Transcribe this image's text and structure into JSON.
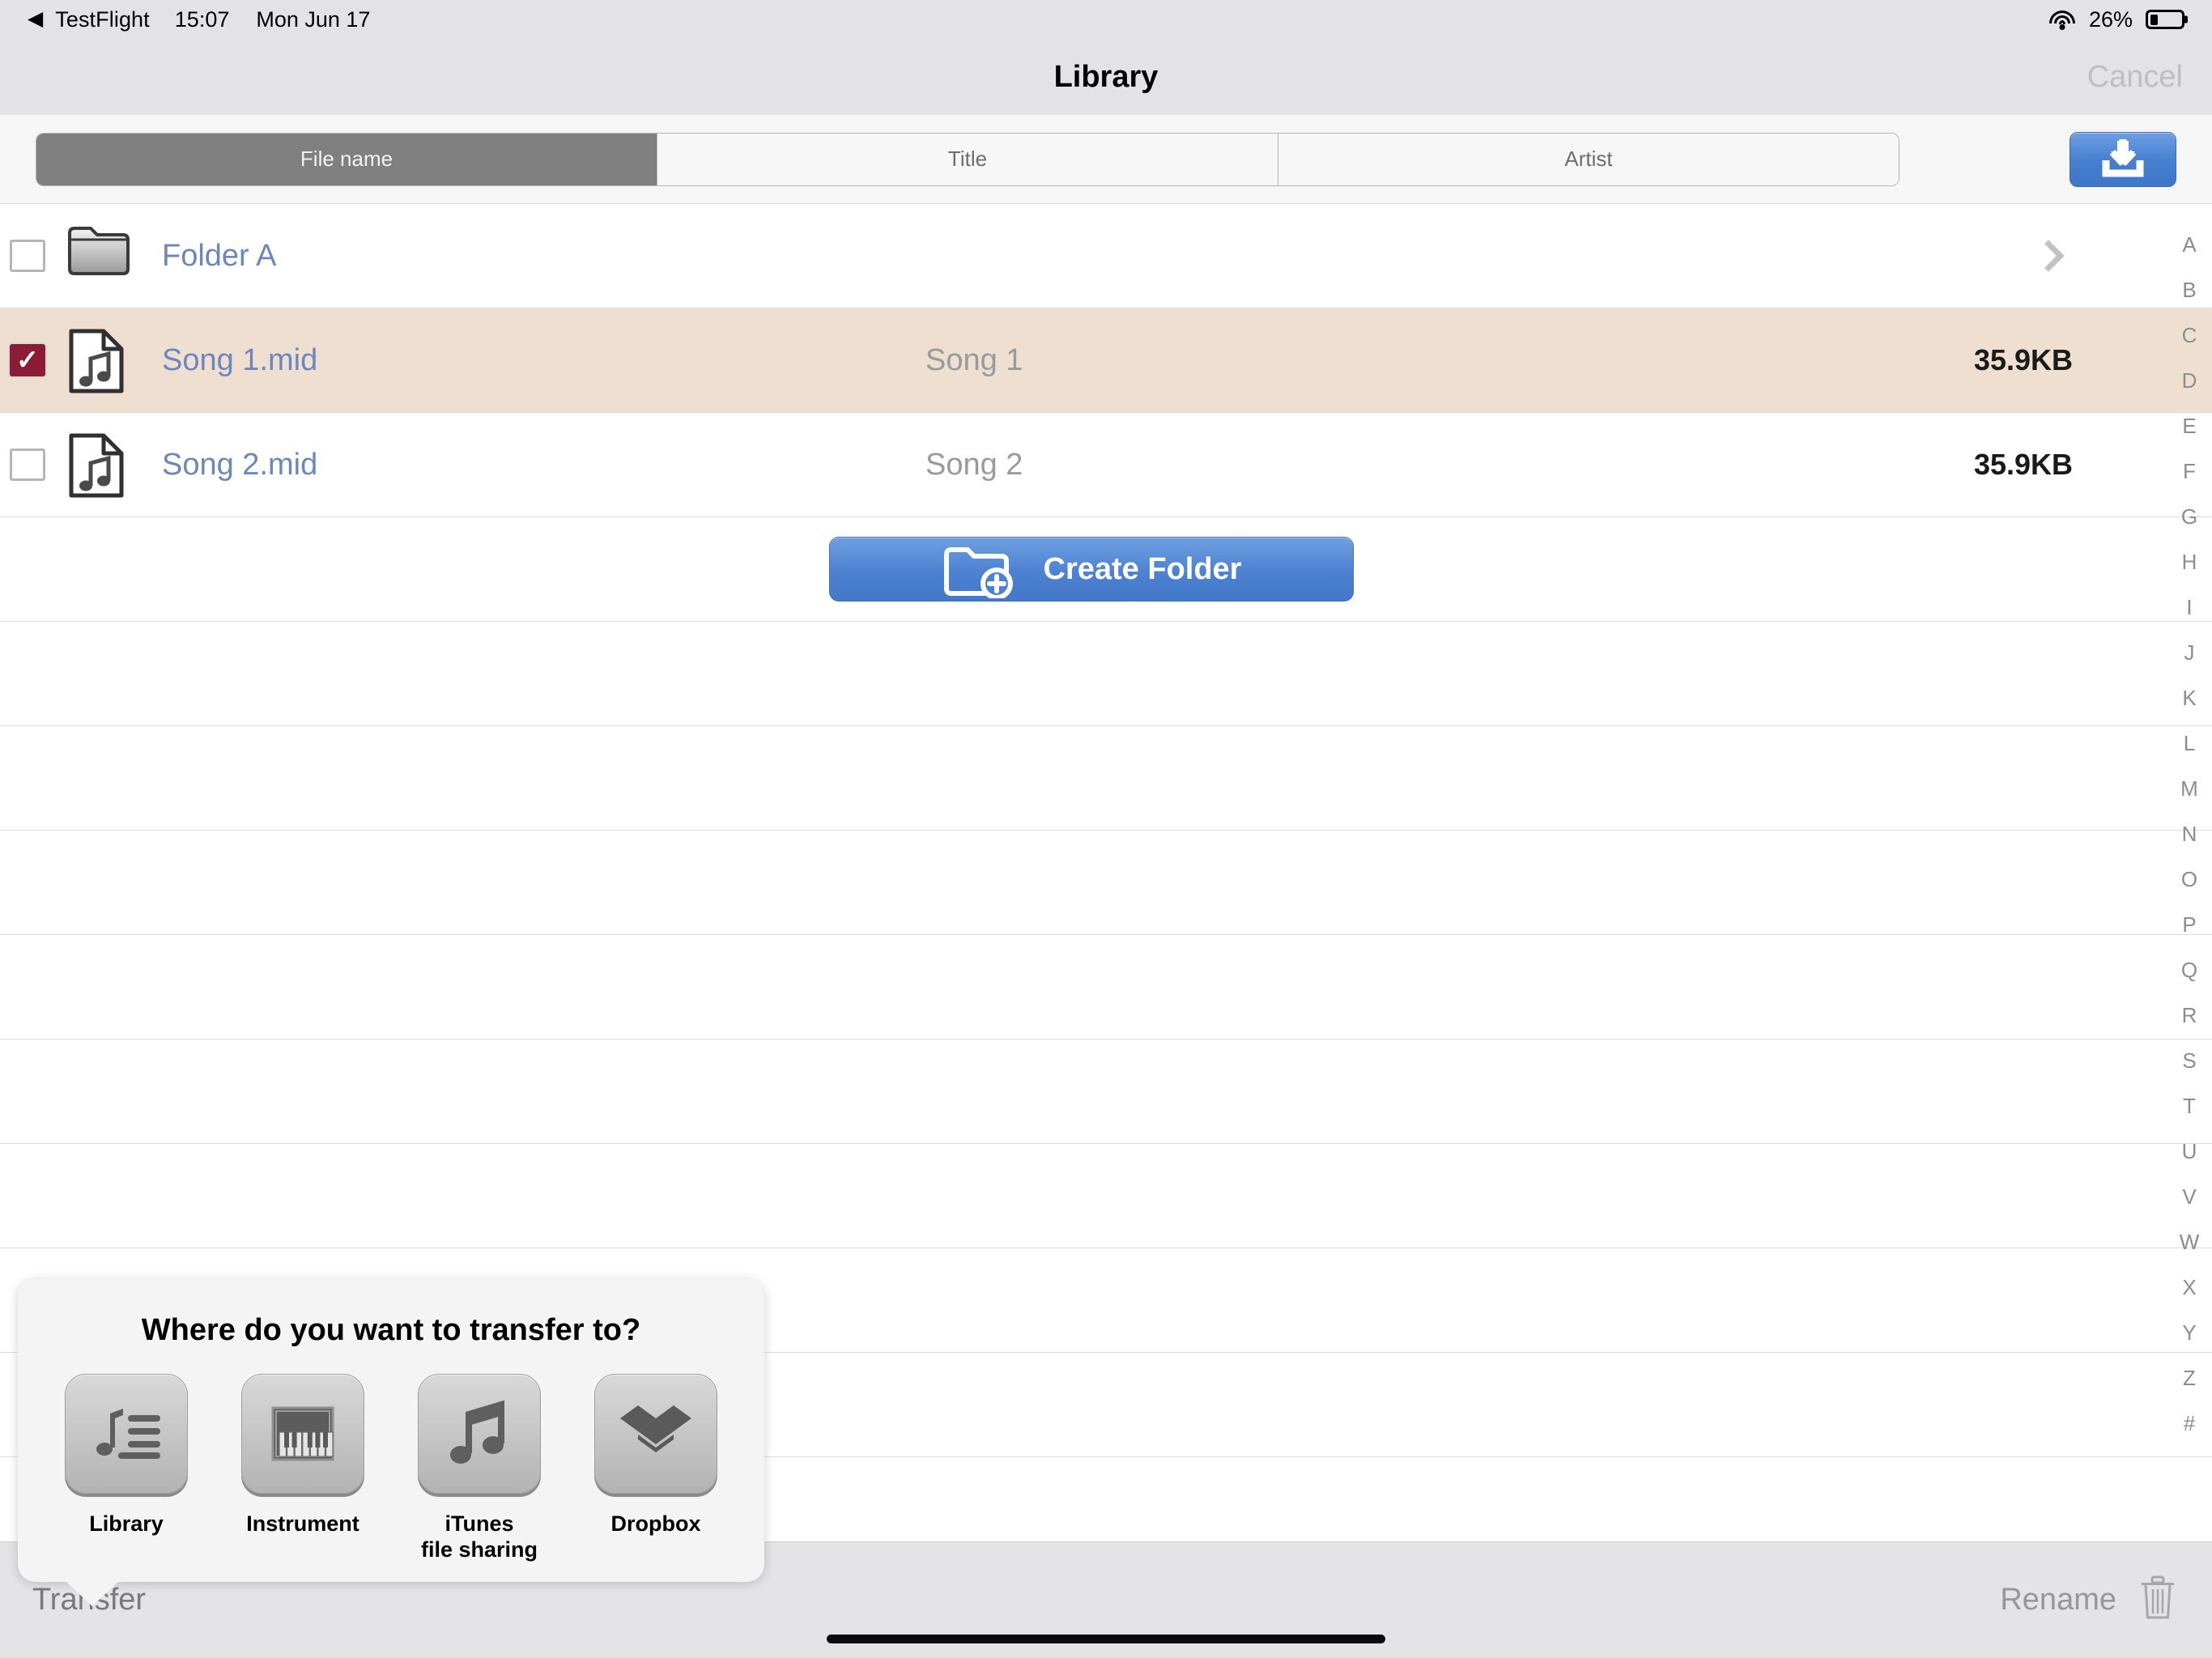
{
  "status_bar": {
    "back_glyph": "◀",
    "back_app": "TestFlight",
    "time": "15:07",
    "date": "Mon Jun 17",
    "battery_percent": "26%",
    "battery_level": 26,
    "wifi_icon": "wifi-icon",
    "battery_icon": "battery-icon"
  },
  "nav": {
    "title": "Library",
    "cancel_label": "Cancel"
  },
  "toolbar": {
    "segments": [
      {
        "label": "File name",
        "active": true
      },
      {
        "label": "Title",
        "active": false
      },
      {
        "label": "Artist",
        "active": false
      }
    ],
    "download_icon": "download-icon"
  },
  "list": {
    "rows": [
      {
        "kind": "folder",
        "name": "Folder A",
        "title": "",
        "size": "",
        "checked": false,
        "icon": "folder-icon",
        "has_chevron": true
      },
      {
        "kind": "file",
        "name": "Song 1.mid",
        "title": "Song 1",
        "size": "35.9KB",
        "checked": true,
        "icon": "music-file-icon",
        "has_chevron": false
      },
      {
        "kind": "file",
        "name": "Song 2.mid",
        "title": "Song 2",
        "size": "35.9KB",
        "checked": false,
        "icon": "music-file-icon",
        "has_chevron": false
      }
    ],
    "create_folder_label": "Create Folder",
    "create_folder_icon": "folder-plus-icon",
    "blank_row_count": 9
  },
  "index_bar": {
    "letters": [
      "A",
      "B",
      "C",
      "D",
      "E",
      "F",
      "G",
      "H",
      "I",
      "J",
      "K",
      "L",
      "M",
      "N",
      "O",
      "P",
      "Q",
      "R",
      "S",
      "T",
      "U",
      "V",
      "W",
      "X",
      "Y",
      "Z",
      "#"
    ]
  },
  "popover": {
    "title": "Where do you want to transfer to?",
    "options": [
      {
        "label": "Library",
        "icon": "music-list-icon"
      },
      {
        "label": "Instrument",
        "icon": "piano-icon"
      },
      {
        "label": "iTunes\nfile sharing",
        "icon": "music-notes-icon"
      },
      {
        "label": "Dropbox",
        "icon": "dropbox-icon"
      }
    ]
  },
  "bottom_bar": {
    "transfer_label": "Transfer",
    "rename_label": "Rename",
    "delete_icon": "trash-icon"
  },
  "colors": {
    "selection_row": "#eedfd0",
    "checkbox_checked": "#8c1b36",
    "link_blue": "#6d87bd",
    "button_blue": "#4d82d2",
    "chrome_gray": "#e3e3e5"
  }
}
